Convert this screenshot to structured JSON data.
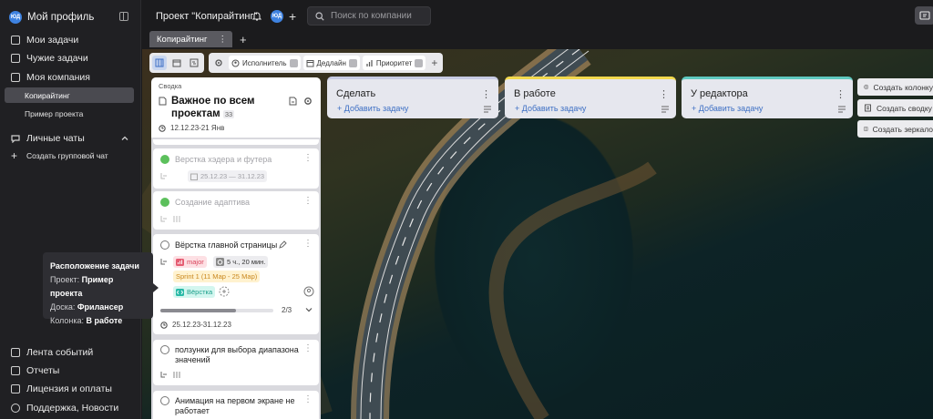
{
  "sidebar": {
    "profile": {
      "avatar": "ЮД",
      "name": "Мой профиль"
    },
    "items": [
      {
        "label": "Мои задачи",
        "icon": "tasks-icon"
      },
      {
        "label": "Чужие задачи",
        "icon": "others-tasks-icon"
      },
      {
        "label": "Моя компания",
        "icon": "company-icon"
      }
    ],
    "sub_items": [
      {
        "label": "Копирайтинг",
        "active": true
      },
      {
        "label": "Пример проекта",
        "active": false
      }
    ],
    "chats": {
      "label": "Личные чаты",
      "create_group": "Создать групповой чат"
    },
    "bottom": [
      {
        "label": "Лента событий",
        "icon": "feed-icon"
      },
      {
        "label": "Отчеты",
        "icon": "reports-icon"
      },
      {
        "label": "Лицензия и оплаты",
        "icon": "license-icon"
      },
      {
        "label": "Поддержка, Новости",
        "icon": "support-icon"
      }
    ]
  },
  "header": {
    "project_title": "Проект \"Копирайтинг\"",
    "avatar": "ЮД",
    "search_placeholder": "Поиск по компании"
  },
  "tabs": [
    {
      "label": "Копирайтинг"
    }
  ],
  "toolbar": {
    "filters": [
      {
        "label": "Исполнитель"
      },
      {
        "label": "Дедлайн"
      },
      {
        "label": "Приоритет"
      }
    ]
  },
  "columns": [
    {
      "title": "Сделать",
      "add": "Добавить задачу",
      "accent": "#c7cbe4"
    },
    {
      "title": "В работе",
      "add": "Добавить задачу",
      "accent": "#f2d94e"
    },
    {
      "title": "У редактора",
      "add": "Добавить задачу",
      "accent": "#5fc9c0"
    }
  ],
  "actions": [
    {
      "label": "Создать колонку"
    },
    {
      "label": "Создать сводку"
    },
    {
      "label": "Создать зеркало"
    }
  ],
  "summary": {
    "label": "Сводка",
    "title": "Важное по всем проектам",
    "count": "33",
    "date": "12.12.23-21 Янв",
    "cards": [
      {
        "title": "Верстка хэдера и футера",
        "date": "25.12.23 — 31.12.23",
        "done": true
      },
      {
        "title": "Создание адаптива",
        "done": true
      },
      {
        "title": "Вёрстка главной страницы",
        "priority": "major",
        "time": "5 ч., 20 мин.",
        "sprint": "Sprint 1 (11 Мар - 25 Мар)",
        "tag": "Вёрстка",
        "progress": "2/3",
        "progress_value": 0.67,
        "date": "25.12.23-31.12.23"
      },
      {
        "title": "ползунки для выбора диапазона значений"
      },
      {
        "title": "Анимация на первом экране не работает"
      }
    ]
  },
  "tooltip": {
    "title": "Расположение задачи",
    "project_label": "Проект:",
    "project": "Пример проекта",
    "board_label": "Доска:",
    "board": "Фрилансер",
    "column_label": "Колонка:",
    "column": "В работе"
  }
}
